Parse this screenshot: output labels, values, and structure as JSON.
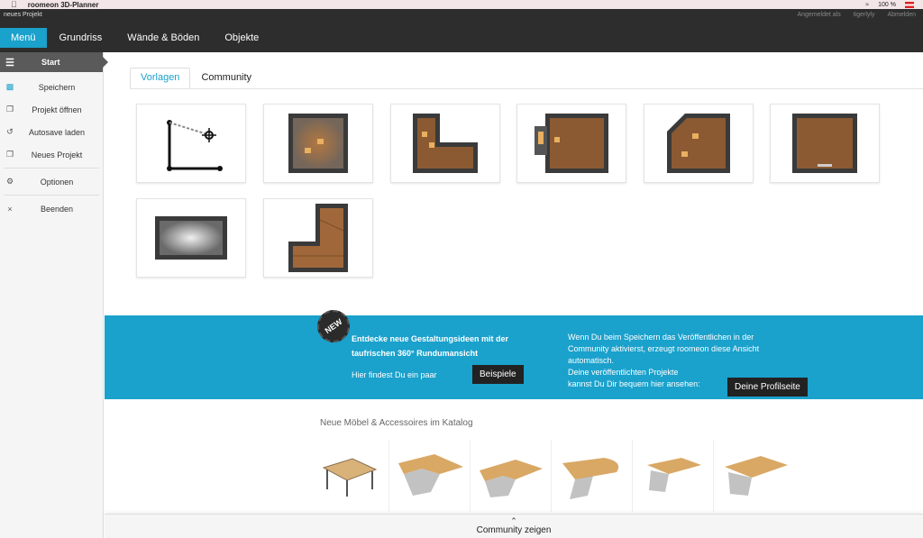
{
  "mac": {
    "app_name": "roomeon 3D-Planner",
    "battery": "100 %"
  },
  "topbar": {
    "project_name": "neues Projekt",
    "logged_in_label": "Angemeldet als",
    "username": "tigerlyly",
    "logout": "Abmelden",
    "nav": [
      "Menü",
      "Grundriss",
      "Wände & Böden",
      "Objekte"
    ]
  },
  "sidebar": {
    "header": "Start",
    "items": [
      {
        "label": "Speichern",
        "icon": "save-icon"
      },
      {
        "label": "Projekt öffnen",
        "icon": "open-icon"
      },
      {
        "label": "Autosave laden",
        "icon": "restore-icon"
      },
      {
        "label": "Neues Projekt",
        "icon": "new-project-icon"
      },
      {
        "label": "Optionen",
        "icon": "gear-icon"
      },
      {
        "label": "Beenden",
        "icon": "close-icon"
      }
    ]
  },
  "tabs": [
    "Vorlagen",
    "Community"
  ],
  "banner": {
    "badge": "NEW",
    "title": "Entdecke neue Gestaltungsideen mit der taufrischen 360° Rundumansicht",
    "find_text": "Hier findest Du ein paar",
    "examples_button": "Beispiele",
    "right_text": "Wenn Du beim Speichern das Veröffentlichen in der Community aktivierst, erzeugt roomeon diese Ansicht automatisch.",
    "right_text2": "Deine veröffentlichten Projekte",
    "right_text3": "kannst Du Dir bequem hier ansehen:",
    "profile_button": "Deine Profilseite"
  },
  "catalog": {
    "title": "Neue Möbel & Accessoires im Katalog"
  },
  "bottom": {
    "label": "Community zeigen"
  },
  "colors": {
    "accent": "#1aa1cc",
    "topbar": "#2d2d2d"
  }
}
